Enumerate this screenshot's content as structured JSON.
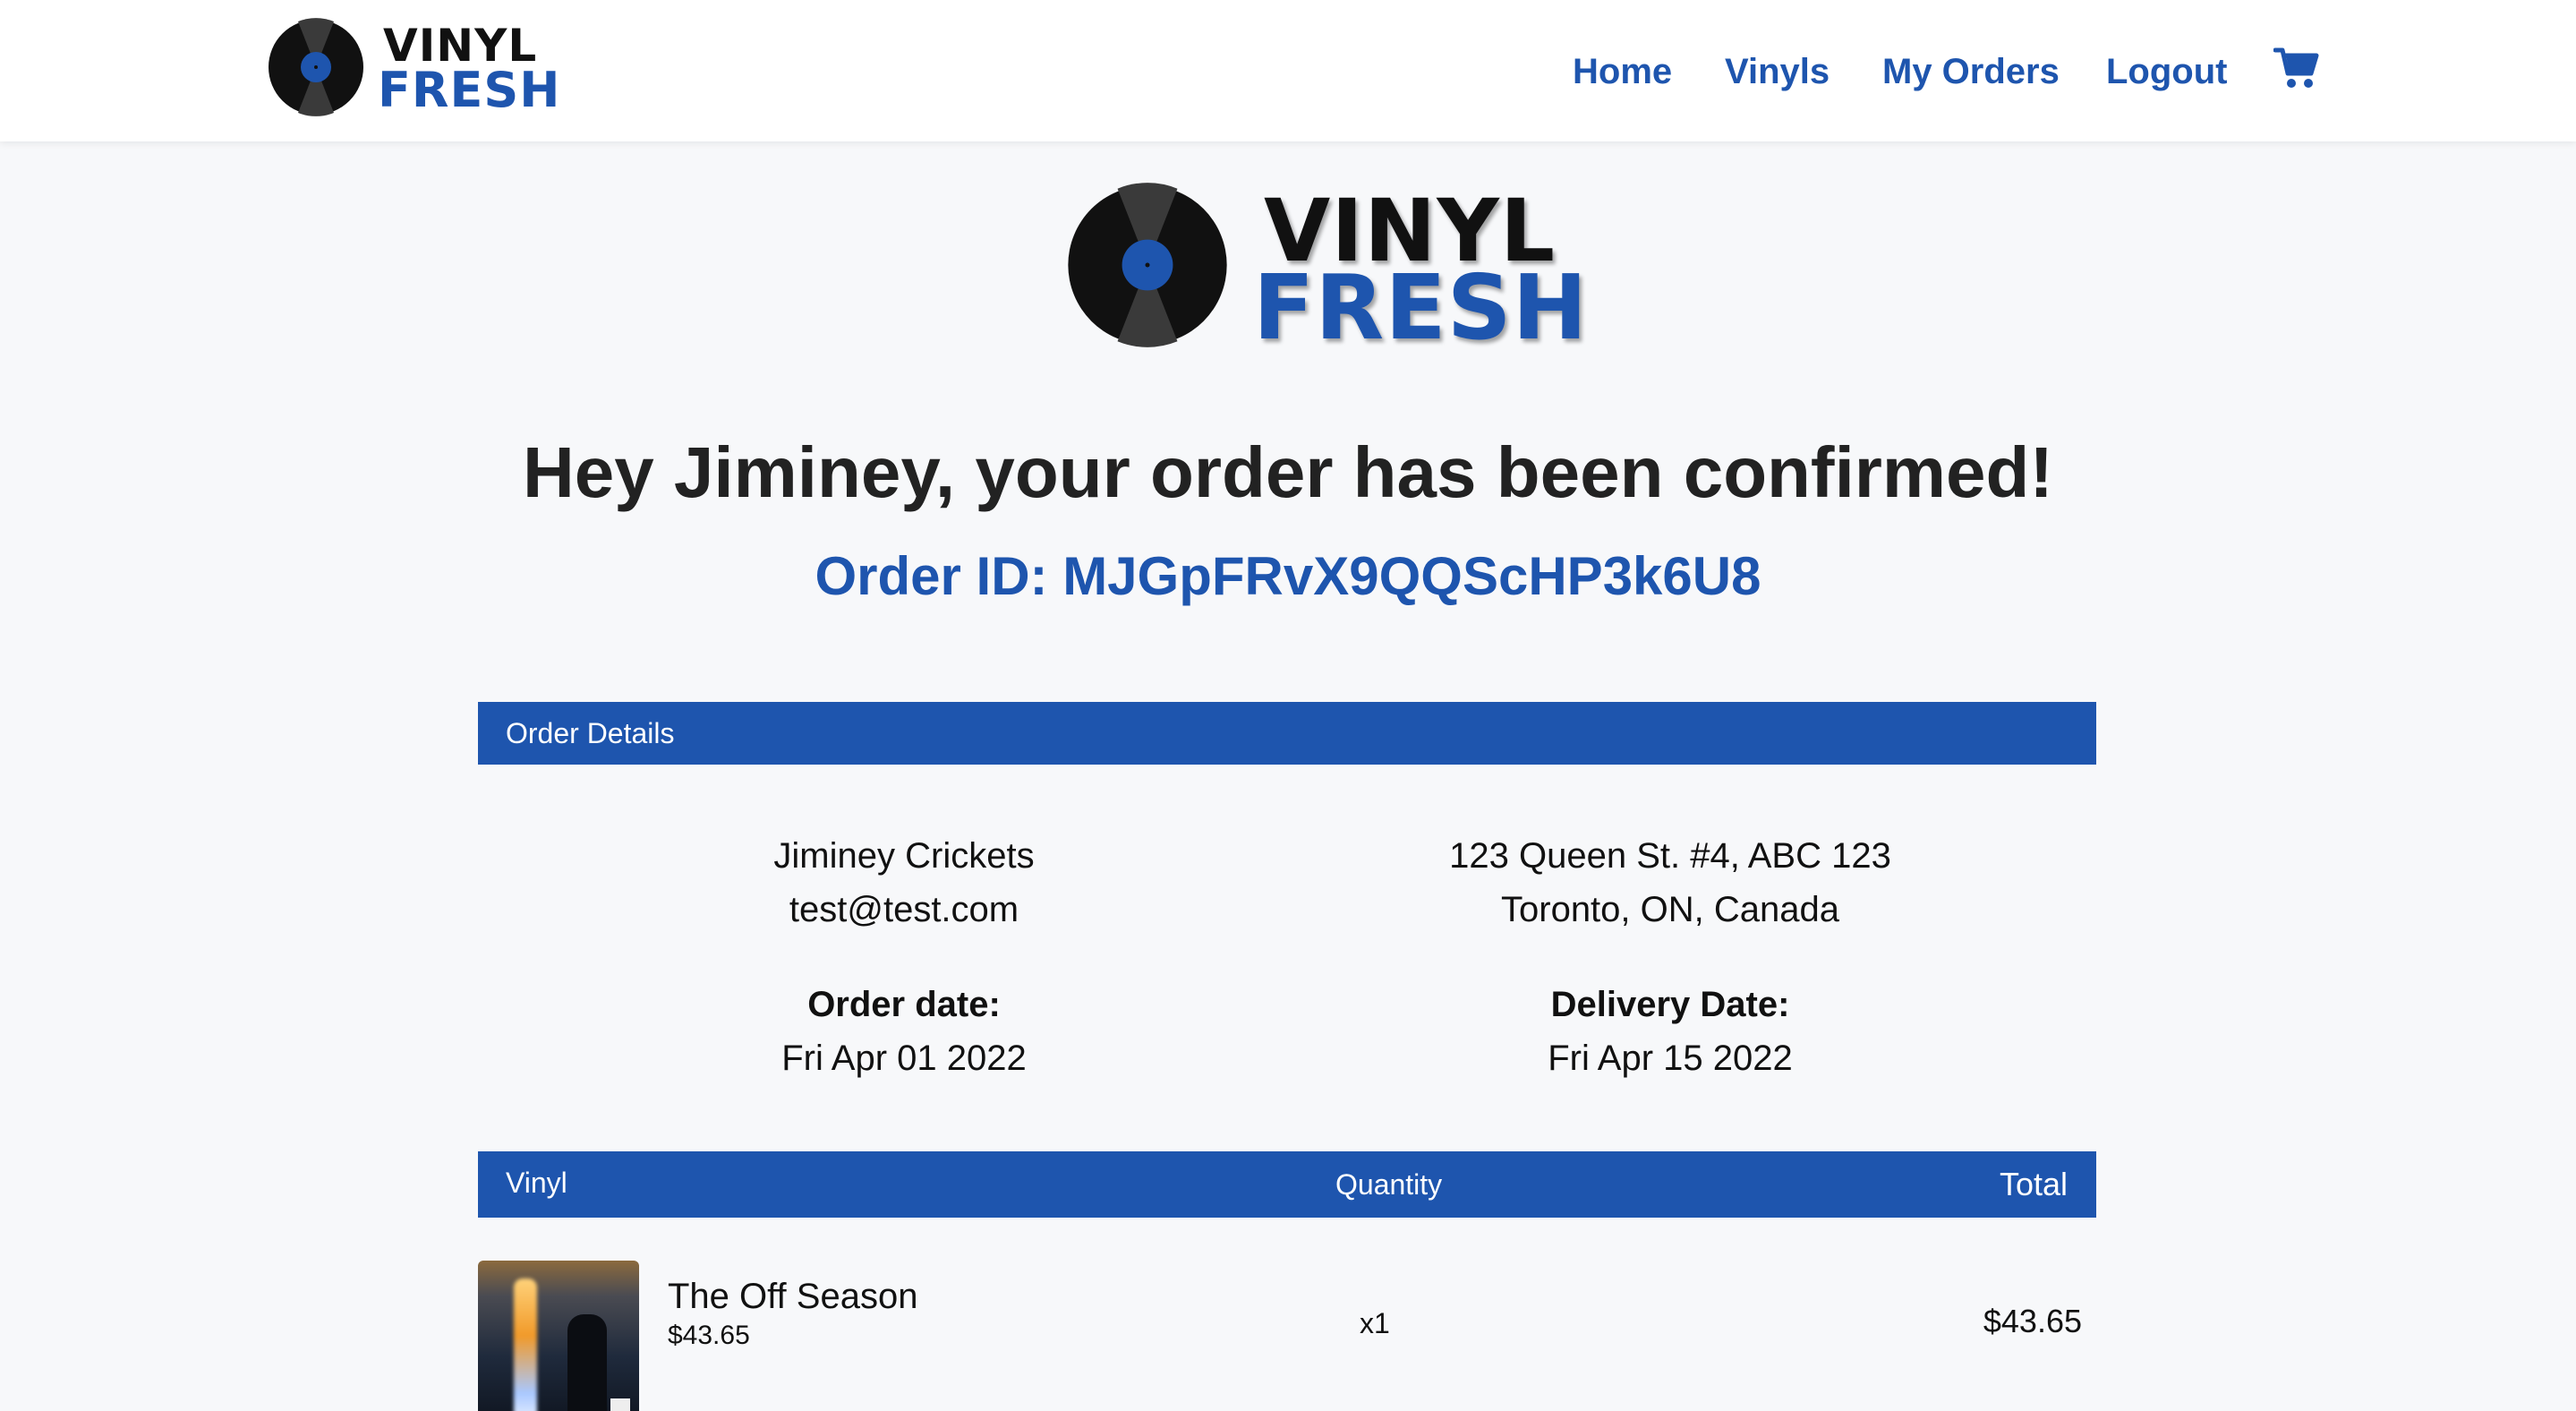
{
  "brand": {
    "line1": "VINYL",
    "line2": "FRESH",
    "accent_color": "#1e55ae"
  },
  "nav": {
    "home": "Home",
    "vinyls": "Vinyls",
    "my_orders": "My Orders",
    "logout": "Logout",
    "cart_icon": "shopping-cart-icon"
  },
  "confirmation": {
    "heading": "Hey Jiminey, your order has been confirmed!",
    "order_id_label": "Order ID: ",
    "order_id": "MJGpFRvX9QQScHP3k6U8"
  },
  "order_details": {
    "section_title": "Order Details",
    "customer_name": "Jiminey Crickets",
    "customer_email": "test@test.com",
    "address_line1": "123 Queen St. #4, ABC 123",
    "address_line2": "Toronto, ON, Canada",
    "order_date_label": "Order date:",
    "order_date": "Fri Apr 01 2022",
    "delivery_date_label": "Delivery Date:",
    "delivery_date": "Fri Apr 15 2022"
  },
  "items_table": {
    "headers": [
      "Vinyl",
      "Quantity",
      "Total"
    ],
    "rows": [
      {
        "title": "The Off Season",
        "unit_price": "$43.65",
        "quantity": "x1",
        "total": "$43.65"
      }
    ]
  }
}
